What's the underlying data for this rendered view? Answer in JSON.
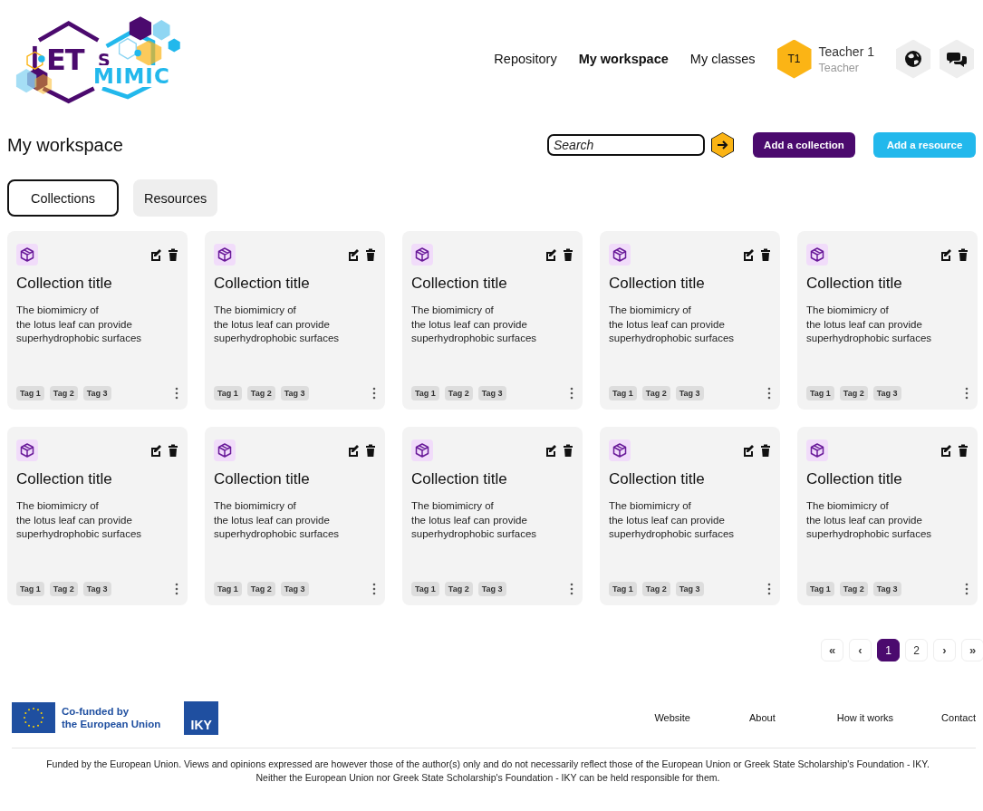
{
  "logo": {
    "word_1": "ET",
    "word_2": "S",
    "word_3": "MIMIC"
  },
  "nav": [
    {
      "label": "Repository",
      "selected": false
    },
    {
      "label": "My workspace",
      "selected": true
    },
    {
      "label": "My classes",
      "selected": false
    }
  ],
  "user": {
    "initials": "T1",
    "name": "Teacher 1",
    "role": "Teacher"
  },
  "page_title": "My workspace",
  "search": {
    "placeholder": "Search"
  },
  "buttons": [
    {
      "label": "Add a collection",
      "kind": "primary"
    },
    {
      "label": "Add a resource",
      "kind": "secondary"
    }
  ],
  "tabs": [
    {
      "label": "Collections",
      "selected": true
    },
    {
      "label": "Resources",
      "selected": false
    }
  ],
  "cards": [
    {
      "title": "Collection title",
      "description": "The biomimicry of\nthe lotus leaf can provide\nsuperhydrophobic surfaces",
      "tags": [
        "Tag 1",
        "Tag 2",
        "Tag 3"
      ]
    },
    {
      "title": "Collection title",
      "description": "The biomimicry of\nthe lotus leaf can provide\nsuperhydrophobic surfaces",
      "tags": [
        "Tag 1",
        "Tag 2",
        "Tag 3"
      ]
    },
    {
      "title": "Collection title",
      "description": "The biomimicry of\nthe lotus leaf can provide\nsuperhydrophobic surfaces",
      "tags": [
        "Tag 1",
        "Tag 2",
        "Tag 3"
      ]
    },
    {
      "title": "Collection title",
      "description": "The biomimicry of\nthe lotus leaf can provide\nsuperhydrophobic surfaces",
      "tags": [
        "Tag 1",
        "Tag 2",
        "Tag 3"
      ]
    },
    {
      "title": "Collection title",
      "description": "The biomimicry of\nthe lotus leaf can provide\nsuperhydrophobic surfaces",
      "tags": [
        "Tag 1",
        "Tag 2",
        "Tag 3"
      ]
    },
    {
      "title": "Collection title",
      "description": "The biomimicry of\nthe lotus leaf can provide\nsuperhydrophobic surfaces",
      "tags": [
        "Tag 1",
        "Tag 2",
        "Tag 3"
      ]
    },
    {
      "title": "Collection title",
      "description": "The biomimicry of\nthe lotus leaf can provide\nsuperhydrophobic surfaces",
      "tags": [
        "Tag 1",
        "Tag 2",
        "Tag 3"
      ]
    },
    {
      "title": "Collection title",
      "description": "The biomimicry of\nthe lotus leaf can provide\nsuperhydrophobic surfaces",
      "tags": [
        "Tag 1",
        "Tag 2",
        "Tag 3"
      ]
    },
    {
      "title": "Collection title",
      "description": "The biomimicry of\nthe lotus leaf can provide\nsuperhydrophobic surfaces",
      "tags": [
        "Tag 1",
        "Tag 2",
        "Tag 3"
      ]
    },
    {
      "title": "Collection title",
      "description": "The biomimicry of\nthe lotus leaf can provide\nsuperhydrophobic surfaces",
      "tags": [
        "Tag 1",
        "Tag 2",
        "Tag 3"
      ]
    }
  ],
  "pagination": [
    {
      "label": "«",
      "kind": "first",
      "selected": false
    },
    {
      "label": "‹",
      "kind": "prev",
      "selected": false
    },
    {
      "label": "1",
      "kind": "page",
      "selected": true
    },
    {
      "label": "2",
      "kind": "page",
      "selected": false
    },
    {
      "label": "›",
      "kind": "next",
      "selected": false
    },
    {
      "label": "»",
      "kind": "last",
      "selected": false
    }
  ],
  "footer": {
    "eu_text": "Co-funded by\nthe European Union",
    "iky_text": "IKY",
    "links": [
      "Website",
      "About",
      "How it works",
      "Contact"
    ],
    "disclaimer": "Funded by the European Union. Views and opinions expressed are however those of the author(s) only and do not necessarily reflect those of the European Union or Greek State Scholarship's Foundation - IKY.\nNeither the European Union nor Greek State Scholarship's Foundation - IKY can be held responsible for them."
  }
}
